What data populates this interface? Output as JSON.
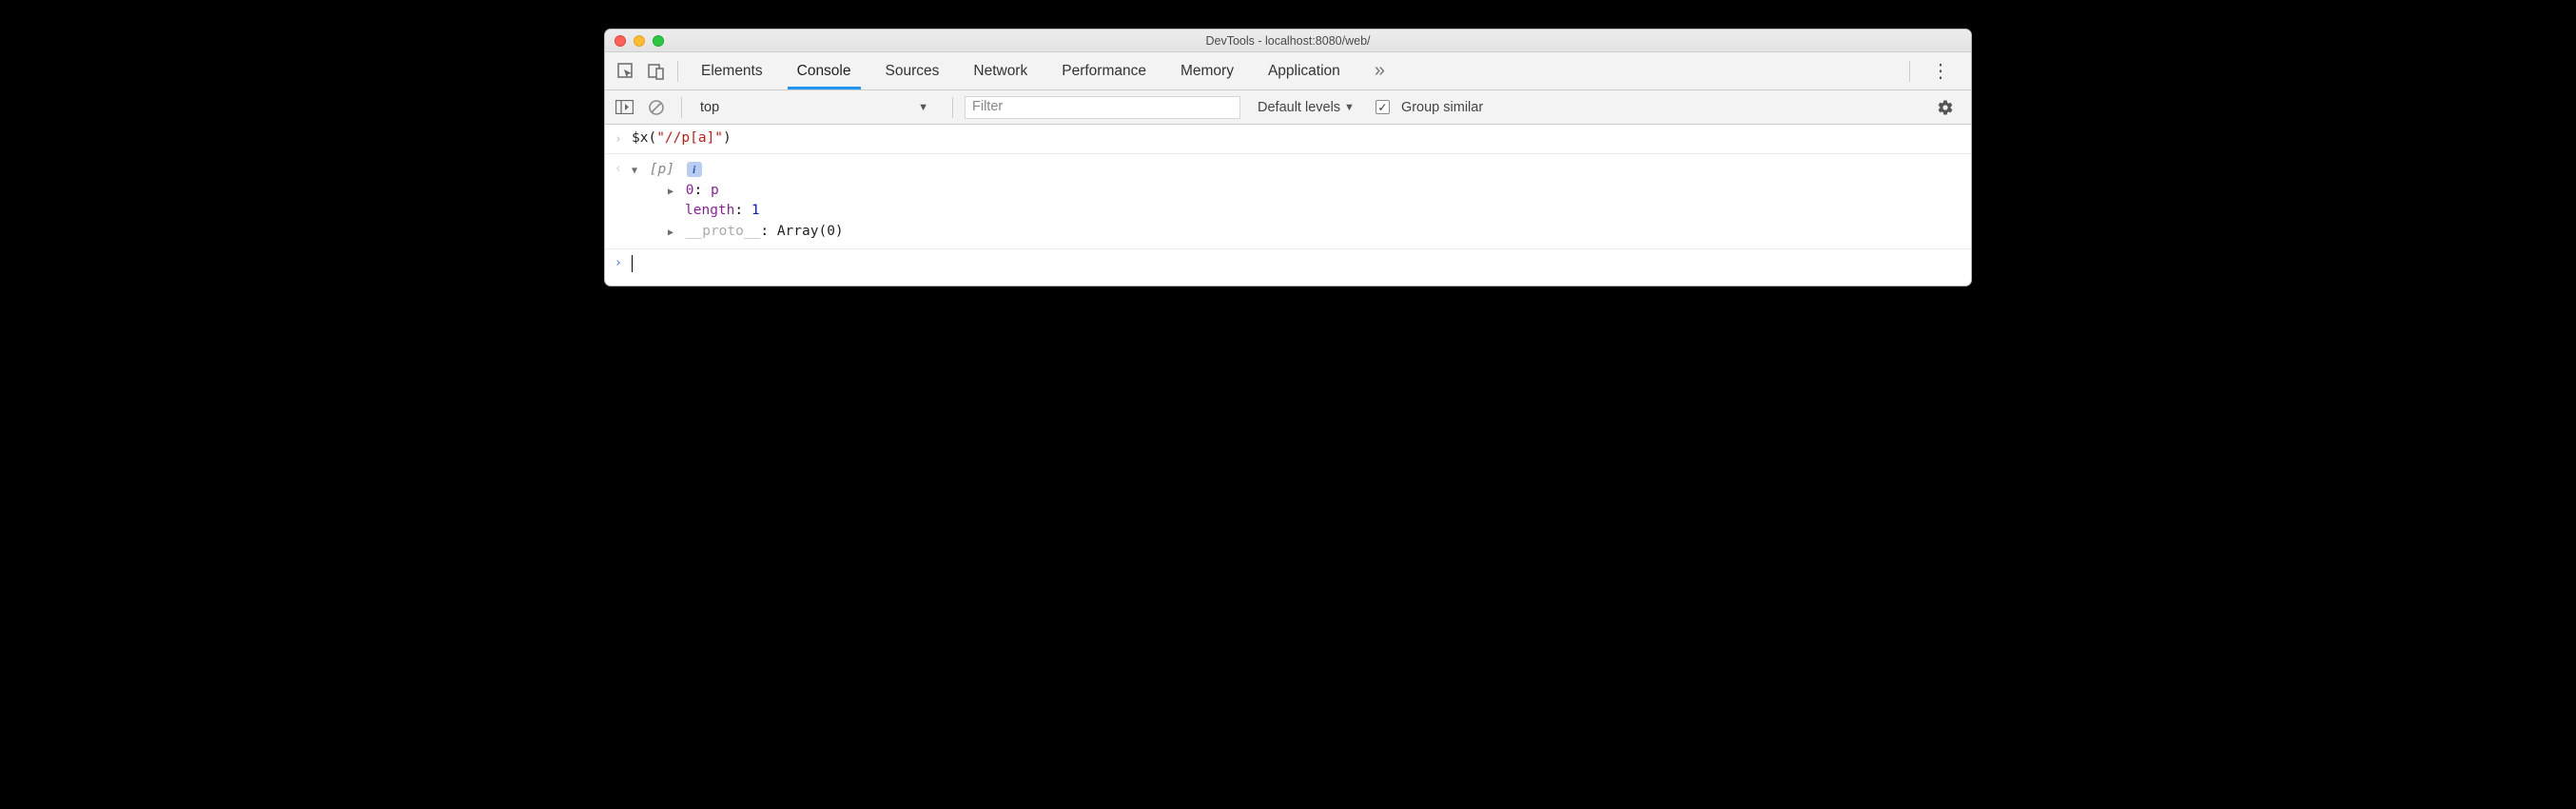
{
  "window": {
    "title": "DevTools - localhost:8080/web/"
  },
  "tabs": {
    "items": [
      {
        "label": "Elements"
      },
      {
        "label": "Console"
      },
      {
        "label": "Sources"
      },
      {
        "label": "Network"
      },
      {
        "label": "Performance"
      },
      {
        "label": "Memory"
      },
      {
        "label": "Application"
      }
    ],
    "active_index": 1
  },
  "filterbar": {
    "context": "top",
    "filter_placeholder": "Filter",
    "filter_value": "",
    "levels_label": "Default levels",
    "group_similar_checked": true,
    "group_similar_label": "Group similar"
  },
  "console": {
    "input_expr": {
      "fn": "$x",
      "open": "(",
      "arg": "\"//p[a]\"",
      "close": ")"
    },
    "result": {
      "preview_open": "[",
      "preview_item": "p",
      "preview_close": "]",
      "info": "i",
      "children": [
        {
          "key": "0",
          "sep": ": ",
          "value": "p",
          "expandable": true,
          "key_kind": "idx",
          "val_kind": "idx"
        },
        {
          "key": "length",
          "sep": ": ",
          "value": "1",
          "expandable": false,
          "key_kind": "idx",
          "val_kind": "num"
        },
        {
          "key": "__proto__",
          "sep": ": ",
          "value": "Array(0)",
          "expandable": true,
          "key_kind": "proto",
          "val_kind": "arr"
        }
      ]
    }
  }
}
